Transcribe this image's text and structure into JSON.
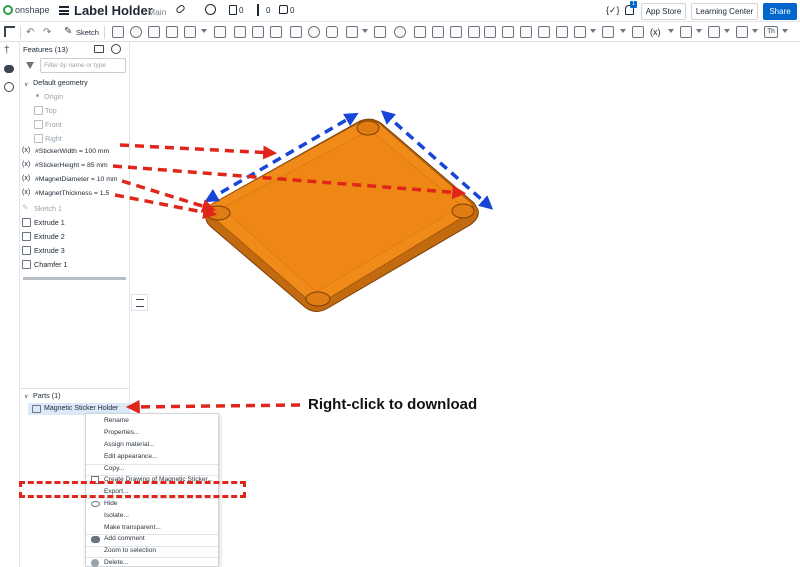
{
  "header": {
    "app_name": "onshape",
    "doc_title": "Label Holder",
    "branch": "Main",
    "versions_count": "0",
    "branches_count": "0",
    "likes_count": "0",
    "notif_count": "1",
    "code_btn": "{✓}",
    "app_store": "App Store",
    "learning_center": "Learning Center",
    "share": "Share"
  },
  "toolbar": {
    "sketch_label": "Sketch",
    "text_icon_label": "Th"
  },
  "features": {
    "title": "Features (13)",
    "filter_placeholder": "Filter by name or type",
    "default_geometry": "Default geometry",
    "geometry": [
      "Origin",
      "Top",
      "Front",
      "Right"
    ],
    "variables": [
      "#StickerWidth = 100 mm",
      "#StickerHeight = 85 mm",
      "#MagnetDiameter = 10 mm",
      "#MagnetThickness = 1.5"
    ],
    "var_icon": "(x)",
    "sketch": "Sketch 1",
    "ops": [
      "Extrude 1",
      "Extrude 2",
      "Extrude 3",
      "Chamfer 1"
    ]
  },
  "parts": {
    "title": "Parts (1)",
    "items": [
      "Magnetic Sticker Holder"
    ]
  },
  "context_menu": {
    "items": [
      "Rename",
      "Properties...",
      "Assign material...",
      "Edit appearance...",
      "Copy...",
      "Create Drawing of Magnetic Sticker...",
      "Export...",
      "Hide",
      "Isolate...",
      "Make transparent...",
      "Add comment",
      "Zoom to selection",
      "Delete..."
    ]
  },
  "annotation": {
    "text": "Right-click to download"
  },
  "colors": {
    "accent": "#0066cc",
    "part_fill": "#f08a19",
    "part_rim": "#c26a10",
    "red_arrow": "#e0261b",
    "blue_arrow": "#1646d8"
  }
}
